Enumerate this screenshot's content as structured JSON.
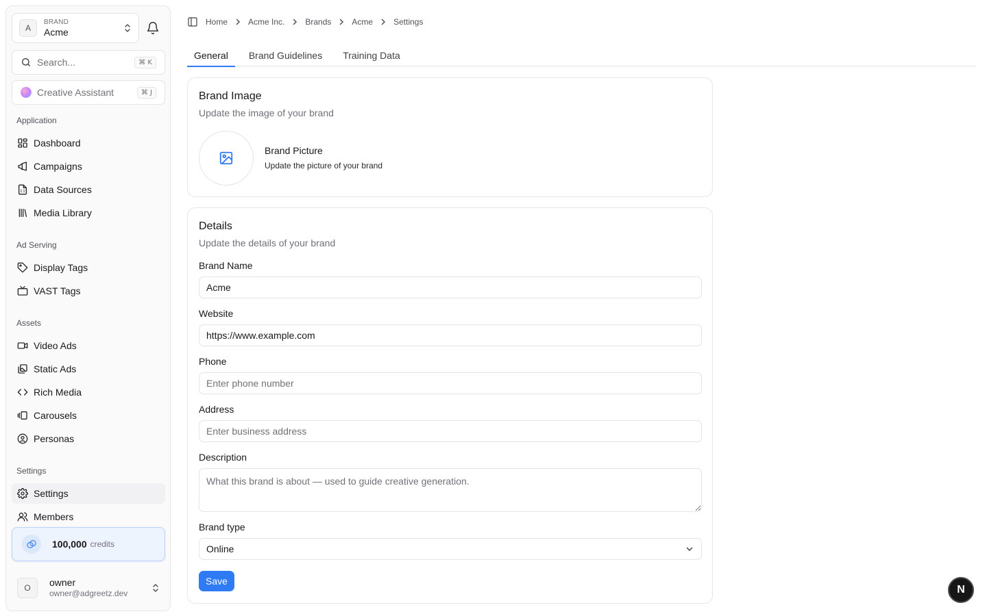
{
  "brand_switcher": {
    "eyebrow": "BRAND",
    "name": "Acme",
    "avatar_letter": "A"
  },
  "search": {
    "placeholder": "Search...",
    "shortcut": "⌘ K"
  },
  "assistant": {
    "label": "Creative Assistant",
    "shortcut": "⌘ J"
  },
  "sidebar": {
    "groups": [
      {
        "label": "Application",
        "items": [
          {
            "label": "Dashboard",
            "icon": "dashboard-icon"
          },
          {
            "label": "Campaigns",
            "icon": "megaphone-icon"
          },
          {
            "label": "Data Sources",
            "icon": "file-spreadsheet-icon"
          },
          {
            "label": "Media Library",
            "icon": "library-icon"
          }
        ]
      },
      {
        "label": "Ad Serving",
        "items": [
          {
            "label": "Display Tags",
            "icon": "tag-icon"
          },
          {
            "label": "VAST Tags",
            "icon": "tv-icon"
          }
        ]
      },
      {
        "label": "Assets",
        "items": [
          {
            "label": "Video Ads",
            "icon": "video-icon"
          },
          {
            "label": "Static Ads",
            "icon": "images-icon"
          },
          {
            "label": "Rich Media",
            "icon": "code-icon"
          },
          {
            "label": "Carousels",
            "icon": "gallery-icon"
          },
          {
            "label": "Personas",
            "icon": "user-circle-icon"
          }
        ]
      },
      {
        "label": "Settings",
        "items": [
          {
            "label": "Settings",
            "icon": "gear-icon",
            "active": true
          },
          {
            "label": "Members",
            "icon": "users-icon"
          }
        ]
      }
    ]
  },
  "credits": {
    "amount": "100,000",
    "unit": "credits"
  },
  "user": {
    "avatar_letter": "O",
    "name": "owner",
    "email": "owner@adgreetz.dev"
  },
  "breadcrumb": [
    "Home",
    "Acme Inc.",
    "Brands",
    "Acme",
    "Settings"
  ],
  "tabs": [
    {
      "label": "General",
      "active": true
    },
    {
      "label": "Brand Guidelines"
    },
    {
      "label": "Training Data"
    }
  ],
  "brand_image_card": {
    "title": "Brand Image",
    "subtitle": "Update the image of your brand",
    "picture_title": "Brand Picture",
    "picture_subtitle": "Update the picture of your brand"
  },
  "details_card": {
    "title": "Details",
    "subtitle": "Update the details of your brand",
    "brand_name": {
      "label": "Brand Name",
      "value": "Acme"
    },
    "website": {
      "label": "Website",
      "value": "https://www.example.com"
    },
    "phone": {
      "label": "Phone",
      "placeholder": "Enter phone number"
    },
    "address": {
      "label": "Address",
      "placeholder": "Enter business address"
    },
    "description": {
      "label": "Description",
      "placeholder": "What this brand is about — used to guide creative generation."
    },
    "brand_type": {
      "label": "Brand type",
      "value": "Online"
    },
    "save_label": "Save"
  },
  "dev_badge": "N",
  "colors": {
    "accent": "#2f7bf5",
    "credits_bg": "#eef4fd"
  }
}
